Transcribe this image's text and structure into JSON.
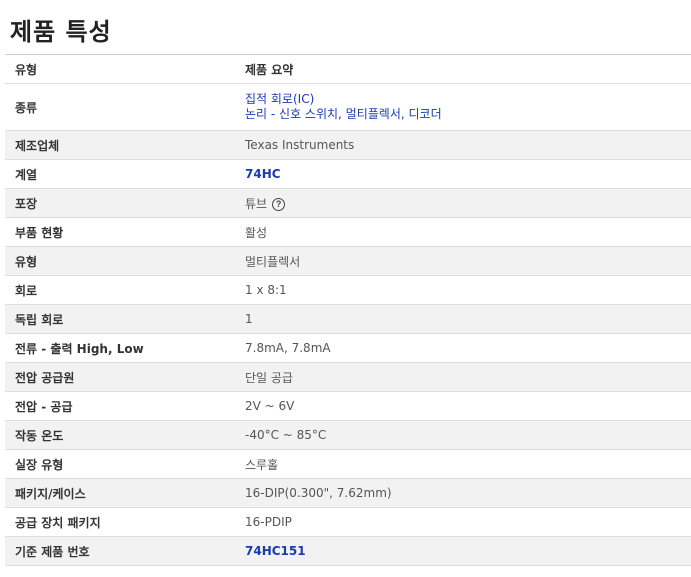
{
  "page": {
    "title": "제품 특성"
  },
  "table": {
    "header": {
      "attribute": "유형",
      "value": "제품 요약"
    },
    "category": {
      "label": "종류",
      "links": [
        "집적 회로(IC)",
        "논리 - 신호 스위치, 멀티플렉서, 디코더"
      ]
    },
    "manufacturer": {
      "label": "제조업체",
      "value": "Texas Instruments"
    },
    "series": {
      "label": "계열",
      "value": "74HC"
    },
    "packaging": {
      "label": "포장",
      "value": "튜브",
      "help_icon": "question-circle-icon"
    },
    "part_status": {
      "label": "부품 현황",
      "value": "활성"
    },
    "type": {
      "label": "유형",
      "value": "멀티플렉서"
    },
    "circuit": {
      "label": "회로",
      "value": "1 x 8:1"
    },
    "independent_circuits": {
      "label": "독립 회로",
      "value": "1"
    },
    "current_output": {
      "label": "전류 - 출력 High, Low",
      "value": "7.8mA, 7.8mA"
    },
    "voltage_supply_source": {
      "label": "전압 공급원",
      "value": "단일 공급"
    },
    "voltage_supply": {
      "label": "전압 - 공급",
      "value": "2V ~ 6V"
    },
    "operating_temp": {
      "label": "작동 온도",
      "value": "-40°C ~ 85°C"
    },
    "mounting_type": {
      "label": "실장 유형",
      "value": "스루홀"
    },
    "package_case": {
      "label": "패키지/케이스",
      "value": "16-DIP(0.300\", 7.62mm)"
    },
    "supplier_package": {
      "label": "공급 장치 패키지",
      "value": "16-PDIP"
    },
    "base_product": {
      "label": "기준 제품 번호",
      "value": "74HC151"
    }
  },
  "colors": {
    "link": "#1a3bb0",
    "alt_row": "#f2f2f2",
    "border": "#dddddd"
  }
}
